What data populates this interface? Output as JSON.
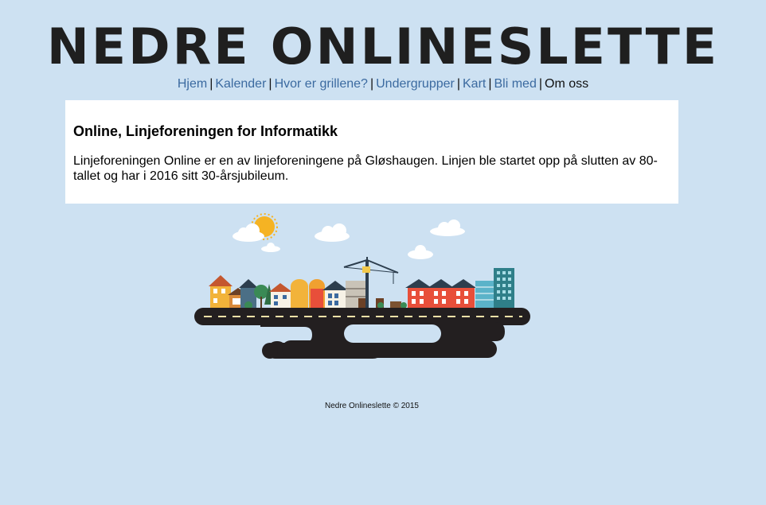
{
  "site": {
    "title": "NEDRE ONLINESLETTE"
  },
  "nav": {
    "items": [
      {
        "label": "Hjem"
      },
      {
        "label": "Kalender"
      },
      {
        "label": "Hvor er grillene?"
      },
      {
        "label": "Undergrupper"
      },
      {
        "label": "Kart"
      },
      {
        "label": "Bli med"
      },
      {
        "label": "Om oss"
      }
    ],
    "separator": "|",
    "link_color": "#3b6aa0"
  },
  "main": {
    "heading": "Online, Linjeforeningen for Informatikk",
    "body": "Linjeforeningen Online er en av linjeforeningene på Gløshaugen. Linjen ble startet opp på slutten av 80-tallet og har i 2016 sitt 30-årsjubileum."
  },
  "illustration": {
    "icon": "city-island-illustration"
  },
  "footer": {
    "text": "Nedre Onlineslette © 2015"
  },
  "colors": {
    "background": "#cde1f2",
    "card": "#ffffff"
  }
}
